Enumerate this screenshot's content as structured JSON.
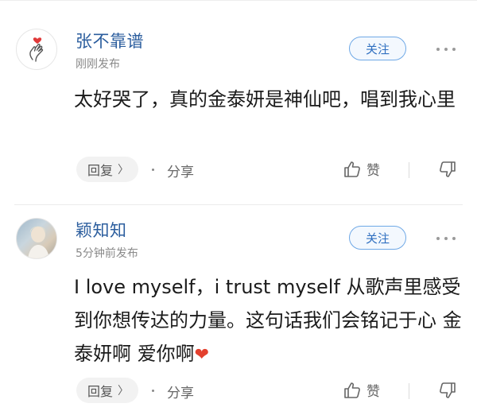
{
  "comments": [
    {
      "username": "张不靠谱",
      "time": "刚刚发布",
      "follow_label": "关注",
      "text": "太好哭了，真的金泰妍是神仙吧，唱到我心里",
      "reply_label": "回复",
      "reply_chevron": "〉",
      "share_label": "分享",
      "like_label": "赞",
      "avatar_icon": "finger-heart-icon"
    },
    {
      "username": "颖知知",
      "time": "5分钟前发布",
      "follow_label": "关注",
      "text": "I love myself，i trust myself 从歌声里感受到你想传达的力量。这句话我们会铭记于心 金泰妍啊 爱你啊",
      "heart": "❤",
      "reply_label": "回复",
      "reply_chevron": "〉",
      "share_label": "分享",
      "like_label": "赞",
      "avatar_icon": "photo-avatar"
    }
  ],
  "colors": {
    "username": "#2c5e9e",
    "follow_border": "#6ea8e6",
    "follow_text": "#2f6fc0",
    "heart": "#e3402e",
    "meta": "#8a8a8a"
  }
}
